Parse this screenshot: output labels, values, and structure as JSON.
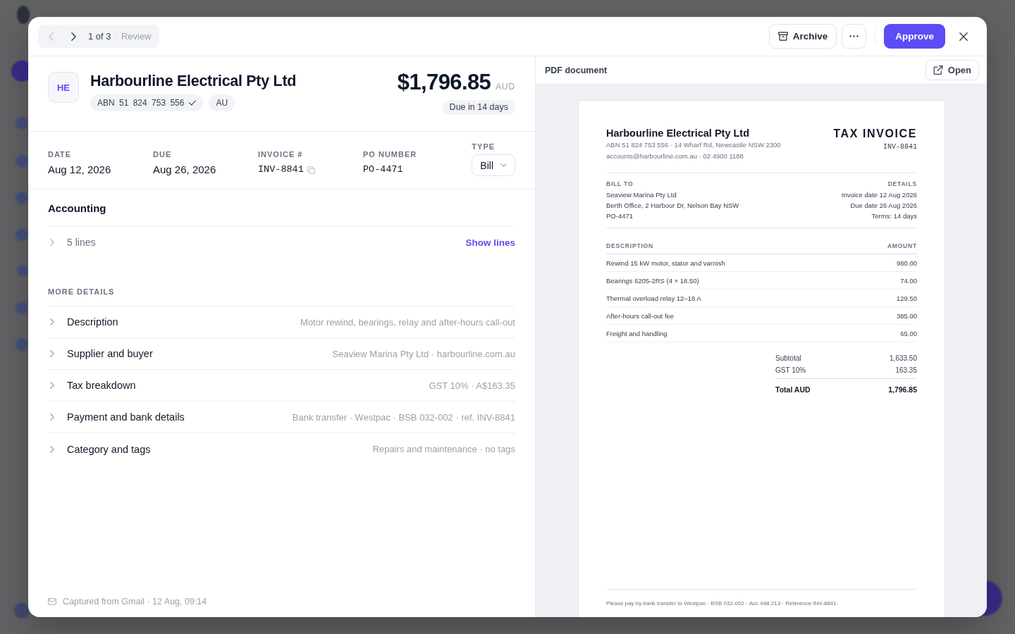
{
  "topbar": {
    "nav": {
      "prev": {
        "disabled": true
      },
      "next": {
        "disabled": false
      },
      "position": "1 of 3",
      "separator": "·",
      "status": "Review"
    },
    "actions": [
      {
        "kind": "archive",
        "label": "Archive"
      },
      {
        "kind": "more"
      },
      {
        "kind": "primary",
        "label": "Approve"
      },
      {
        "kind": "close"
      }
    ]
  },
  "header": {
    "initials": "HE",
    "name": "Harbourline Electrical Pty Ltd",
    "chips": [
      {
        "label": "ABN 51 824 753 556",
        "verified": true
      },
      {
        "label": "AU",
        "verified": false
      }
    ],
    "amount": "$1,796.85",
    "currency": "AUD",
    "due_badge": "Due in 14 days"
  },
  "fields": [
    {
      "label": "DATE",
      "value": "Aug 12, 2026",
      "kind": "text",
      "copyable": false
    },
    {
      "label": "DUE",
      "value": "Aug 26, 2026",
      "kind": "text",
      "copyable": false
    },
    {
      "label": "INVOICE #",
      "value": "INV-8841",
      "kind": "code",
      "copyable": true
    },
    {
      "label": "PO NUMBER",
      "value": "PO-4471",
      "kind": "code",
      "copyable": false
    }
  ],
  "type_field": {
    "label": "TYPE",
    "value": "Bill"
  },
  "accounting": {
    "title": "Accounting",
    "lines": {
      "label": "5 lines",
      "expanded": false,
      "action": "Show lines"
    }
  },
  "more_details": {
    "title": "MORE DETAILS",
    "rows": [
      {
        "label": "Description",
        "value": "Motor rewind, bearings, relay and after-hours call-out",
        "expanded": false
      },
      {
        "label": "Supplier and buyer",
        "value": "Seaview Marina Pty Ltd · harbourline.com.au",
        "expanded": false
      },
      {
        "label": "Tax breakdown",
        "value": "GST 10% · A$163.35",
        "expanded": false
      },
      {
        "label": "Payment and bank details",
        "value": "Bank transfer · Westpac · BSB 032-002 · ref. INV-8841",
        "expanded": false
      },
      {
        "label": "Category and tags",
        "value": "Repairs and maintenance · no tags",
        "expanded": false
      }
    ]
  },
  "footer": {
    "source": "Captured from Gmail · 12 Aug, 09:14"
  },
  "preview": {
    "title": "PDF document",
    "open_button": "Open",
    "document": {
      "seller": {
        "name": "Harbourline Electrical Pty Ltd",
        "lines": [
          "ABN 51 824 753 556 · 14 Wharf Rd, Newcastle NSW 2300",
          "accounts@harbourline.com.au · 02 4900 1188"
        ]
      },
      "title": "TAX INVOICE",
      "number": "INV-8841",
      "bill_to": {
        "heading": "BILL TO",
        "lines": [
          "Seaview Marina Pty Ltd",
          "Berth Office, 2 Harbour Dr, Nelson Bay NSW",
          "PO-4471"
        ]
      },
      "details": {
        "heading": "DETAILS",
        "lines": [
          "Invoice date 12 Aug 2026",
          "Due date 26 Aug 2026",
          "Terms: 14 days"
        ]
      },
      "table": {
        "columns": [
          "DESCRIPTION",
          "AMOUNT"
        ],
        "rows": [
          {
            "description": "Rewind 15 kW motor, stator and varnish",
            "amount": "980.00"
          },
          {
            "description": "Bearings 6205-2RS (4 × 18.50)",
            "amount": "74.00"
          },
          {
            "description": "Thermal overload relay 12–18 A",
            "amount": "129.50"
          },
          {
            "description": "After-hours call-out fee",
            "amount": "385.00"
          },
          {
            "description": "Freight and handling",
            "amount": "65.00"
          }
        ]
      },
      "totals": [
        {
          "label": "Subtotal",
          "value": "1,633.50",
          "kind": "sub"
        },
        {
          "label": "GST 10%",
          "value": "163.35",
          "kind": "sub"
        },
        {
          "label": "Total AUD",
          "value": "1,796.85",
          "kind": "total"
        }
      ],
      "footer": "Please pay by bank transfer to Westpac · BSB 032-002 · Acc 448 213 · Reference INV-8841."
    }
  }
}
